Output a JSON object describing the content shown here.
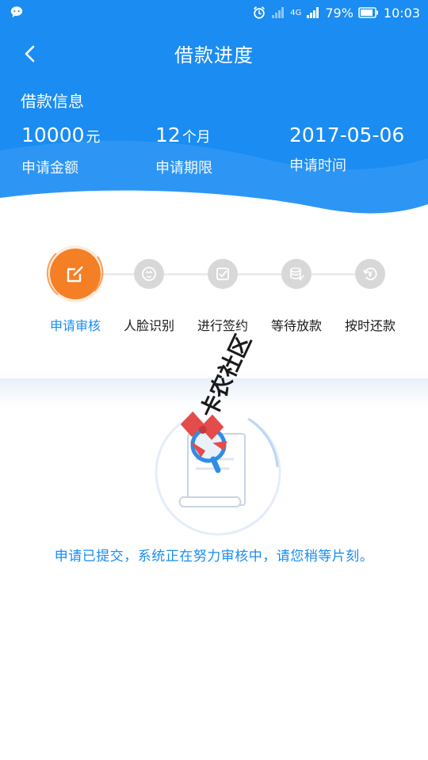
{
  "statusbar": {
    "network": "4G",
    "battery": "79%",
    "time": "10:03",
    "icons": [
      "chat-bubble-icon",
      "alarm-icon",
      "signal-icon",
      "battery-icon"
    ]
  },
  "navbar": {
    "title": "借款进度"
  },
  "loan_info": {
    "section_title": "借款信息",
    "items": [
      {
        "value": "10000",
        "unit": "元",
        "label": "申请金额"
      },
      {
        "value": "12",
        "unit": "个月",
        "label": "申请期限"
      },
      {
        "value": "2017-05-06",
        "unit": "",
        "label": "申请时间"
      }
    ]
  },
  "steps": [
    {
      "label": "申请审核",
      "status": "active",
      "icon": "edit-icon"
    },
    {
      "label": "人脸识别",
      "status": "pending",
      "icon": "face-icon"
    },
    {
      "label": "进行签约",
      "status": "pending",
      "icon": "check-square-icon"
    },
    {
      "label": "等待放款",
      "status": "pending",
      "icon": "coin-stack-icon"
    },
    {
      "label": "按时还款",
      "status": "pending",
      "icon": "repay-icon"
    }
  ],
  "message": "申请已提交，系统正在努力审核中，请您稍等片刻。",
  "watermark": "卡农社区",
  "colors": {
    "primary": "#1a8cf2",
    "accent": "#f57f25",
    "inactive": "#d8d8d8"
  }
}
